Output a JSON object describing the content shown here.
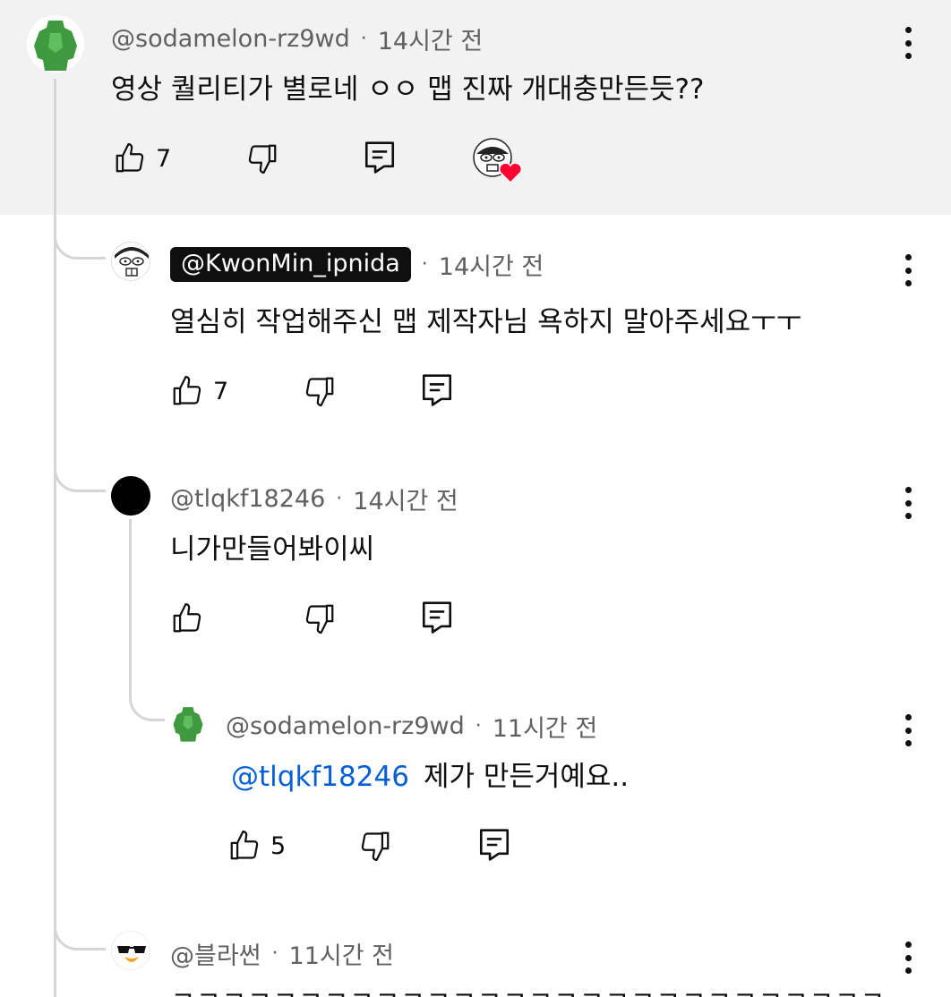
{
  "comments": [
    {
      "handle": "@sodamelon-rz9wd",
      "time": "14시간 전",
      "text": "영상 퀄리티가 별로네 ㅇㅇ 맵 진짜 개대충만든듯??",
      "likes": "7",
      "avatar": "green-figure",
      "creator_heart": true
    },
    {
      "handle": "@KwonMin_ipnida",
      "time": "14시간 전",
      "text": "열심히 작업해주신 맵 제작자님 욕하지 말아주세요ㅜㅜ",
      "likes": "7",
      "avatar": "cartoon-face",
      "is_channel_owner": true
    },
    {
      "handle": "@tlqkf18246",
      "time": "14시간 전",
      "text": "니가만들어봐이씨",
      "likes": "",
      "avatar": "black-circle"
    },
    {
      "handle": "@sodamelon-rz9wd",
      "time": "11시간 전",
      "mention": "@tlqkf18246",
      "text": "제가 만든거예요..",
      "likes": "5",
      "avatar": "green-figure"
    },
    {
      "handle": "@블라썬",
      "time": "11시간 전",
      "text": "ㅋㅋㅋㅋㅋㅋㅋㅋㅋㅋㅋㅋㅋㅋㅋㅋㅋㅋㅋㅋㅋㅋㅋㅋㅋㅋㅋㅋㅋㅋㅋㅋㅋㅋㅋㅋㅋㅋㅋㅋㅋ",
      "avatar": "sunglasses-bird"
    }
  ],
  "separator": "·",
  "colors": {
    "highlight_bg": "#f2f2f2",
    "mention": "#065fd4",
    "heart": "#ff0033",
    "thread_line": "#d6d6d6"
  },
  "icons": [
    "thumb-up-icon",
    "thumb-down-icon",
    "reply-icon",
    "more-vert-icon",
    "heart-icon"
  ]
}
